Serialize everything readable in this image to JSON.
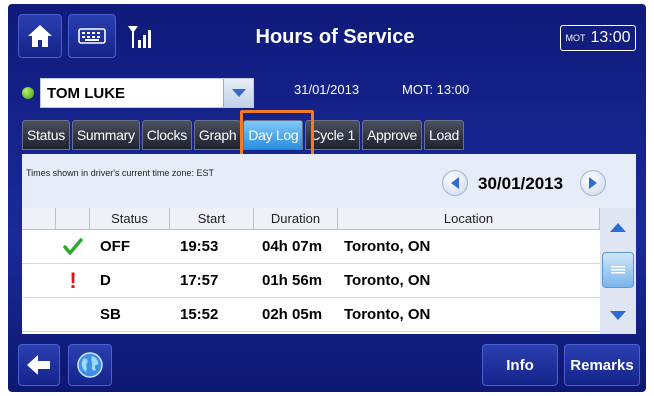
{
  "header": {
    "title": "Hours of Service",
    "clock_tz": "MOT",
    "clock_time": "13:00"
  },
  "driver": {
    "name": "TOM LUKE",
    "date": "31/01/2013",
    "mot": "MOT: 13:00"
  },
  "tabs": [
    {
      "label": "Status"
    },
    {
      "label": "Summary"
    },
    {
      "label": "Clocks"
    },
    {
      "label": "Graph"
    },
    {
      "label": "Day Log"
    },
    {
      "label": "Cycle 1"
    },
    {
      "label": "Approve"
    },
    {
      "label": "Load"
    }
  ],
  "active_tab": "Day Log",
  "panel": {
    "tz_note": "Times shown in driver's current time zone: EST",
    "date": "30/01/2013"
  },
  "table": {
    "headers": [
      "",
      "",
      "Status",
      "Start",
      "Duration",
      "Location"
    ],
    "rows": [
      {
        "flag": "check",
        "status": "OFF",
        "start": "19:53",
        "duration": "04h 07m",
        "location": "Toronto, ON"
      },
      {
        "flag": "exclamation",
        "status": "D",
        "start": "17:57",
        "duration": "01h 56m",
        "location": "Toronto, ON"
      },
      {
        "flag": "",
        "status": "SB",
        "start": "15:52",
        "duration": "02h 05m",
        "location": "Toronto, ON"
      }
    ]
  },
  "footer": {
    "info_label": "Info",
    "remarks_label": "Remarks"
  },
  "colors": {
    "background": "#1a2a9a",
    "active_tab": "#2a8fe0",
    "highlight": "#f07a28",
    "status_ok": "#2ea82e",
    "status_alert": "#e2141a"
  }
}
